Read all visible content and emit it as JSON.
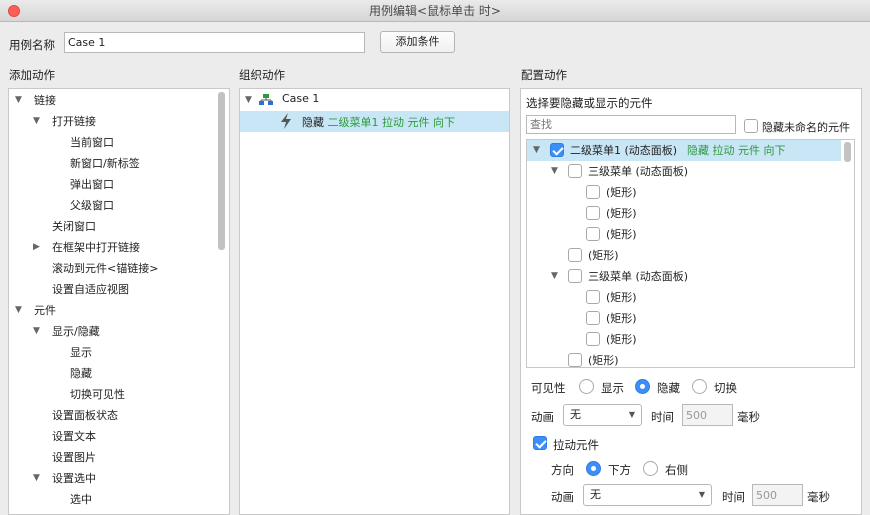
{
  "window": {
    "title": "用例编辑<鼠标单击 时>"
  },
  "case_name": {
    "label": "用例名称",
    "value": "Case 1",
    "add_condition": "添加条件"
  },
  "add_action": {
    "title": "添加动作",
    "items": [
      {
        "label": "链接",
        "expanded": true
      },
      {
        "label": "打开链接",
        "expanded": true
      },
      {
        "label": "当前窗口"
      },
      {
        "label": "新窗口/新标签"
      },
      {
        "label": "弹出窗口"
      },
      {
        "label": "父级窗口"
      },
      {
        "label": "关闭窗口"
      },
      {
        "label": "在框架中打开链接",
        "expanded": false
      },
      {
        "label": "滚动到元件<锚链接>"
      },
      {
        "label": "设置自适应视图"
      },
      {
        "label": "元件",
        "expanded": true
      },
      {
        "label": "显示/隐藏",
        "expanded": true
      },
      {
        "label": "显示"
      },
      {
        "label": "隐藏"
      },
      {
        "label": "切换可见性"
      },
      {
        "label": "设置面板状态"
      },
      {
        "label": "设置文本"
      },
      {
        "label": "设置图片"
      },
      {
        "label": "设置选中",
        "expanded": true
      },
      {
        "label": "选中"
      }
    ]
  },
  "organize": {
    "title": "组织动作",
    "case_label": "Case 1",
    "action_verb": "隐藏",
    "action_detail": "二级菜单1 拉动 元件 向下"
  },
  "configure": {
    "title": "配置动作",
    "subtitle": "选择要隐藏或显示的元件",
    "search_placeholder": "查找",
    "hide_unnamed_label": "隐藏未命名的元件",
    "tree": [
      {
        "label": "二级菜单1 (动态面板)",
        "detail": "隐藏 拉动 元件 向下",
        "checked": true
      },
      {
        "label": "三级菜单 (动态面板)",
        "checked": false
      },
      {
        "label": "(矩形)",
        "checked": false
      },
      {
        "label": "(矩形)",
        "checked": false
      },
      {
        "label": "(矩形)",
        "checked": false
      },
      {
        "label": "(矩形)",
        "checked": false
      },
      {
        "label": "三级菜单 (动态面板)",
        "checked": false
      },
      {
        "label": "(矩形)",
        "checked": false
      },
      {
        "label": "(矩形)",
        "checked": false
      },
      {
        "label": "(矩形)",
        "checked": false
      },
      {
        "label": "(矩形)",
        "checked": false
      }
    ],
    "visibility": {
      "label": "可见性",
      "options": [
        "显示",
        "隐藏",
        "切换"
      ],
      "selected": "隐藏"
    },
    "animation": {
      "label": "动画",
      "value": "无",
      "time_label": "时间",
      "time_value": "500",
      "unit": "毫秒"
    },
    "push": {
      "label": "拉动元件",
      "checked": true
    },
    "direction": {
      "label": "方向",
      "options": [
        "下方",
        "右侧"
      ],
      "selected": "下方"
    },
    "push_animation": {
      "label": "动画",
      "value": "无",
      "time_label": "时间",
      "time_value": "500",
      "unit": "毫秒"
    }
  },
  "colors": {
    "accent": "#3d8ff7",
    "selection": "#c8e6f5",
    "highlight_text": "#2b9a3c"
  }
}
